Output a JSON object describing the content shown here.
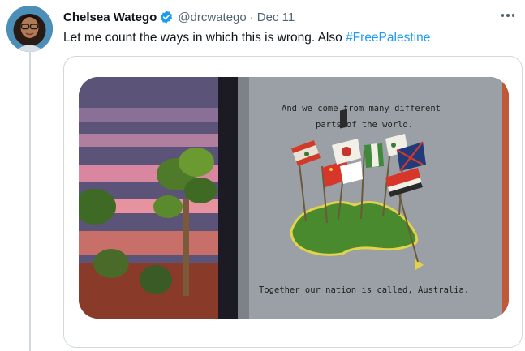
{
  "tweet": {
    "author": {
      "display_name": "Chelsea Watego",
      "handle": "@drcwatego",
      "verified": true
    },
    "separator": "·",
    "date": "Dec 11",
    "text_main": "Let me count the ways in which this is wrong. Also ",
    "hashtag": "#FreePalestine",
    "more_icon": "ellipsis-icon",
    "media": {
      "book_text": {
        "line1": "And we come from many different",
        "line2": "parts of the world.",
        "footer": "Together our nation is called, Australia."
      }
    }
  },
  "colors": {
    "text_primary": "#0f1419",
    "text_secondary": "#536471",
    "accent": "#1d9bf0",
    "border": "#cfd9de"
  }
}
